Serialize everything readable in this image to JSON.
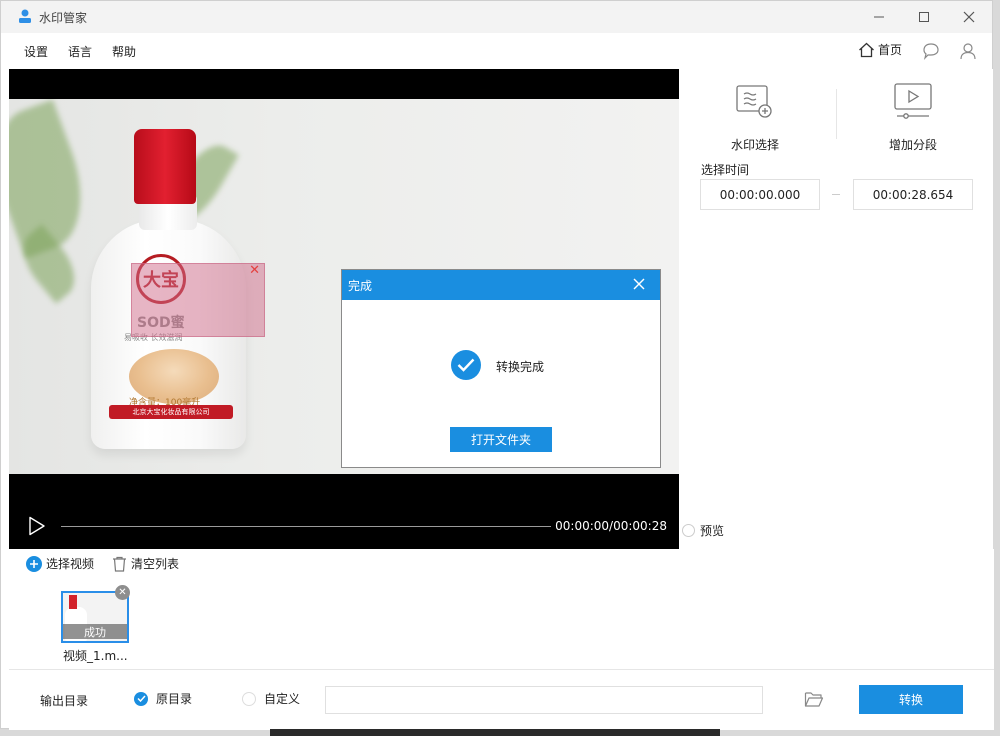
{
  "window": {
    "title": "水印管家"
  },
  "menu": {
    "settings": "设置",
    "language": "语言",
    "help": "帮助",
    "home": "首页"
  },
  "video": {
    "timecode": "00:00:00/00:00:28"
  },
  "product": {
    "logo_text": "大宝",
    "brand": "SOD蜜",
    "tagline": "易吸收 长效滋润",
    "volume": "净含量：100毫升",
    "maker": "北京大宝化妆品有限公司"
  },
  "panel": {
    "watermark_select": "水印选择",
    "add_segment": "增加分段",
    "select_time": "选择时间",
    "start_time": "00:00:00.000",
    "end_time": "00:00:28.654",
    "preview": "预览"
  },
  "dialog": {
    "title": "完成",
    "message": "转换完成",
    "open_folder": "打开文件夹"
  },
  "list": {
    "select_video": "选择视频",
    "clear_list": "清空列表",
    "items": [
      {
        "name": "视频_1.m...",
        "status": "成功"
      }
    ]
  },
  "output": {
    "label": "输出目录",
    "original": "原目录",
    "custom": "自定义",
    "path": "",
    "convert": "转换"
  },
  "colors": {
    "accent": "#1a8ee0",
    "video_bg": "#000000"
  }
}
